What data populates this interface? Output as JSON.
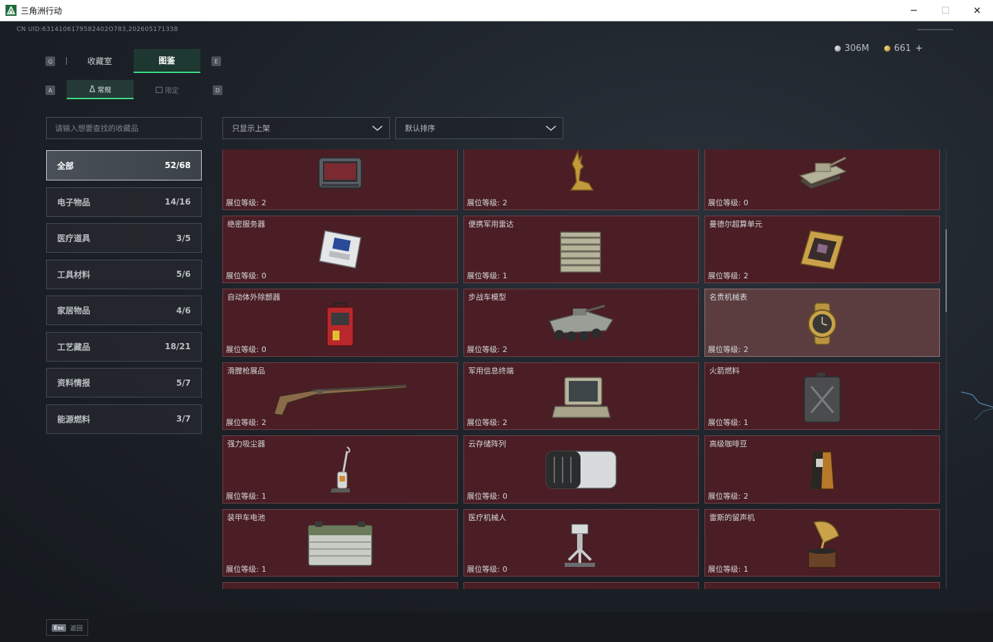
{
  "window": {
    "title": "三角洲行动",
    "minimize": "─",
    "maximize": "☐",
    "close": "✕"
  },
  "header": {
    "uid": "CN UID:6314106179582402O783,202605171338"
  },
  "currency": {
    "silver": "306M",
    "gold": "661",
    "plus": "+"
  },
  "keyhints": {
    "left_tab": "Q",
    "right_tab": "E",
    "left_sub": "A",
    "right_sub": "D"
  },
  "tabs": [
    {
      "label": "收藏室"
    },
    {
      "label": "图鉴"
    }
  ],
  "subtabs": [
    {
      "label": "常规"
    },
    {
      "label": "限定"
    }
  ],
  "search": {
    "placeholder": "请输入想要查找的收藏品"
  },
  "filters": {
    "display": "只显示上架",
    "sort": "默认排序"
  },
  "categories": [
    {
      "label": "全部",
      "count": "52/68"
    },
    {
      "label": "电子物品",
      "count": "14/16"
    },
    {
      "label": "医疗道具",
      "count": "3/5"
    },
    {
      "label": "工具材料",
      "count": "5/6"
    },
    {
      "label": "家居物品",
      "count": "4/6"
    },
    {
      "label": "工艺藏品",
      "count": "18/21"
    },
    {
      "label": "资料情报",
      "count": "5/7"
    },
    {
      "label": "能源燃料",
      "count": "3/7"
    }
  ],
  "level_label": "展位等级:",
  "items": [
    {
      "name": "",
      "level": "2",
      "icon": "radio-icon"
    },
    {
      "name": "",
      "level": "2",
      "icon": "golden-deer-icon"
    },
    {
      "name": "",
      "level": "0",
      "icon": "tank-model-icon"
    },
    {
      "name": "绝密服务器",
      "level": "0",
      "icon": "server-icon"
    },
    {
      "name": "便携军用雷达",
      "level": "1",
      "icon": "radar-icon"
    },
    {
      "name": "曼德尔超算单元",
      "level": "2",
      "icon": "cpu-unit-icon"
    },
    {
      "name": "自动体外除颤器",
      "level": "0",
      "icon": "defibrillator-icon"
    },
    {
      "name": "步战车模型",
      "level": "2",
      "icon": "ifv-model-icon"
    },
    {
      "name": "名贵机械表",
      "level": "2",
      "icon": "watch-icon"
    },
    {
      "name": "滑膛枪展品",
      "level": "2",
      "icon": "musket-icon"
    },
    {
      "name": "军用信息终端",
      "level": "2",
      "icon": "terminal-icon"
    },
    {
      "name": "火箭燃料",
      "level": "1",
      "icon": "fuel-can-icon"
    },
    {
      "name": "强力吸尘器",
      "level": "1",
      "icon": "vacuum-icon"
    },
    {
      "name": "云存储阵列",
      "level": "0",
      "icon": "storage-array-icon"
    },
    {
      "name": "高级咖啡豆",
      "level": "2",
      "icon": "coffee-bag-icon"
    },
    {
      "name": "装甲车电池",
      "level": "1",
      "icon": "battery-icon"
    },
    {
      "name": "医疗机械人",
      "level": "0",
      "icon": "medical-robot-icon"
    },
    {
      "name": "雷斯的留声机",
      "level": "1",
      "icon": "gramophone-icon"
    }
  ],
  "footer": {
    "esc_key": "Esc",
    "esc_label": "返回"
  },
  "colors": {
    "accent": "#3ddc84",
    "card_bg": "#4a1e24",
    "card_highlight": "#5c3d3f"
  }
}
